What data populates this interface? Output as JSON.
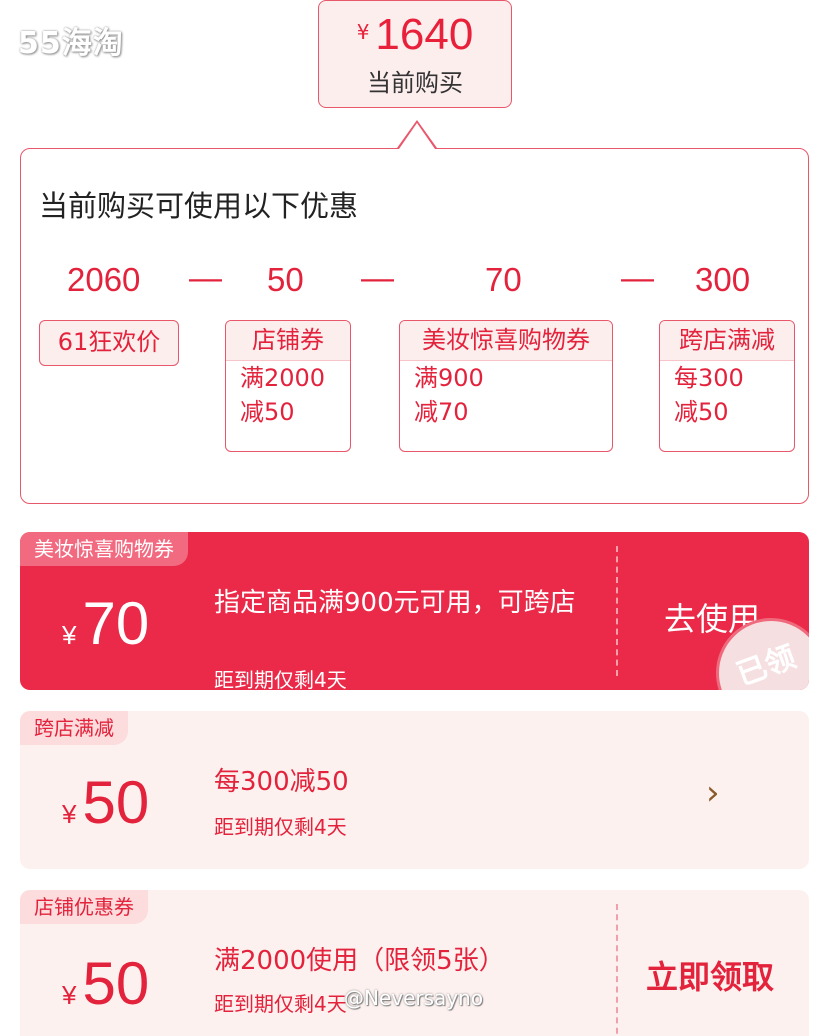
{
  "watermark_logo": "55海淘",
  "price_tip": {
    "currency": "¥",
    "amount": "1640",
    "caption": "当前购买"
  },
  "detail": {
    "title": "当前购买可使用以下优惠",
    "calc": {
      "n1": "2060",
      "n2": "50",
      "n3": "70",
      "n4": "300",
      "minus": "—"
    },
    "tags": {
      "promo": "61狂欢价",
      "store": {
        "head": "店铺券",
        "line1": "满2000",
        "line2": "减50"
      },
      "beauty": {
        "head": "美妆惊喜购物券",
        "line1": "满900",
        "line2": "减70"
      },
      "cross": {
        "head": "跨店满减",
        "line1": "每300",
        "line2": "减50"
      }
    }
  },
  "coupons": [
    {
      "badge": "美妆惊喜购物券",
      "currency": "¥",
      "amount": "70",
      "desc": "指定商品满900元可用，可跨店",
      "sub": "距到期仅剩4天",
      "action": "去使用",
      "stamp": "已领"
    },
    {
      "badge": "跨店满减",
      "currency": "¥",
      "amount": "50",
      "desc": "每300减50",
      "sub": "距到期仅剩4天",
      "action": "›"
    },
    {
      "badge": "店铺优惠券",
      "currency": "¥",
      "amount": "50",
      "desc": "满2000使用（限领5张）",
      "sub": "距到期仅剩4天",
      "action": "立即领取"
    }
  ],
  "watermark_user": "@Neversayno",
  "colors": {
    "accent": "#e3223c",
    "coupon_active": "#ea2a48",
    "coupon_bg": "#fdf1ef"
  }
}
